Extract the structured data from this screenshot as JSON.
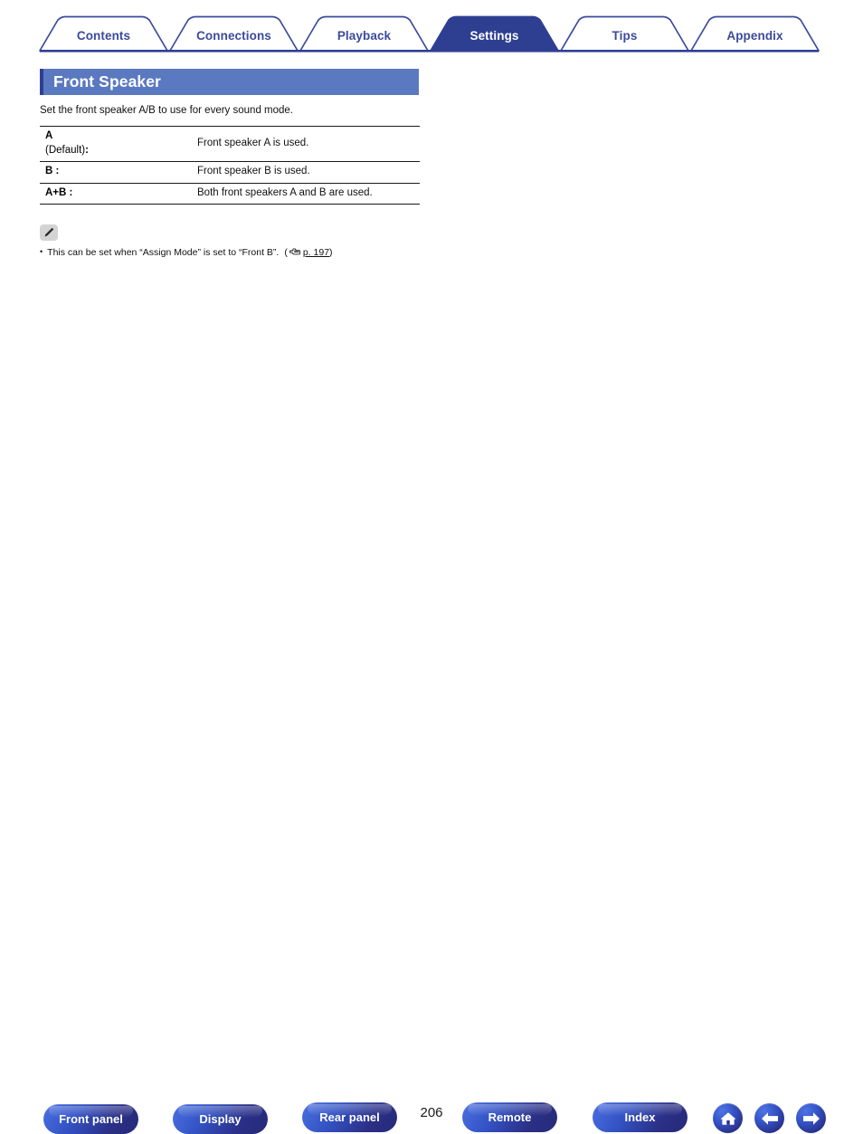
{
  "nav_tabs": [
    {
      "label": "Contents",
      "active": false
    },
    {
      "label": "Connections",
      "active": false
    },
    {
      "label": "Playback",
      "active": false
    },
    {
      "label": "Settings",
      "active": true
    },
    {
      "label": "Tips",
      "active": false
    },
    {
      "label": "Appendix",
      "active": false
    }
  ],
  "section": {
    "title": "Front Speaker",
    "intro": "Set the front speaker A/B to use for every sound mode."
  },
  "option_table": {
    "rows": [
      {
        "key_main": "A",
        "key_sub": "(Default)",
        "key_colon": ":",
        "value": "Front speaker A is used."
      },
      {
        "key_main": "B :",
        "key_sub": "",
        "key_colon": "",
        "value": "Front speaker B is used."
      },
      {
        "key_main": "A+B :",
        "key_sub": "",
        "key_colon": "",
        "value": "Both front speakers A and B are used."
      }
    ]
  },
  "note": {
    "icon": "pencil-icon",
    "bullet": "•",
    "text": "This can be set when “Assign Mode” is set to “Front B”.",
    "ref_open": "(",
    "ref_hand": "pointing-hand-icon",
    "ref_page": "p. 197",
    "ref_close": ")"
  },
  "footer": {
    "buttons": [
      {
        "label": "Front panel",
        "name": "front-panel-button"
      },
      {
        "label": "Display",
        "name": "display-button"
      },
      {
        "label": "Rear panel",
        "name": "rear-panel-button"
      },
      {
        "label": "Remote",
        "name": "remote-button"
      },
      {
        "label": "Index",
        "name": "index-button"
      }
    ],
    "page_number": "206",
    "icons": [
      {
        "name": "home-icon"
      },
      {
        "name": "arrow-left-icon"
      },
      {
        "name": "arrow-right-icon"
      }
    ]
  },
  "colors": {
    "tab_navy": "#2e3f92",
    "banner_blue": "#5b79c0",
    "banner_accent": "#2e3f92",
    "text_black": "#111111",
    "note_icon_bg": "#d4d4d4"
  }
}
